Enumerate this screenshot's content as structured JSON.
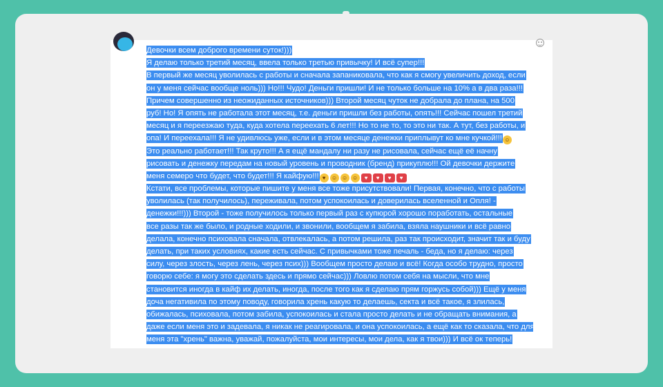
{
  "lines": [
    "Девочки всем доброго времени суток!)))",
    "Я делаю только третий месяц, ввела  только третью привычку! И всё супер!!!",
    "В первый же месяц уволилась с работы и сначала запаниковала, что как я смогу увеличить доход, если",
    "он у меня сейчас вообще ноль))) Но!!! Чудо! Деньги пришли! И не только больше на 10% а в два раза!!!",
    "Причем совершенно из неожиданных источников))) Второй месяц чуток не добрала до плана, на 500",
    "руб! Но! Я опять не работала этот месяц, т.е. деньги пришли без работы, опять!!! Сейчас пошел третий",
    "месяц и я переезжаю туда, куда хотела переехать 6 лет!!! Но то не то, то это ни так. А тут, без работы, и",
    "опа! И переехала!!! Я не удивлюсь уже, если и в этом месяце денежки приплывут ко мне кучкой!!!",
    "Это реально работает!!! Так круто!!! А я ещё мандалу ни разу не рисовала, сейчас ещё её начну",
    "рисовать и денежку передам на новый уровень и проводник (бренд) прикуплю!!! Ой девочки держите",
    "меня семеро что будет, что будет!!! Я кайфую!!!",
    "Кстати, все проблемы, которые пишите у меня все тоже присутствовали! Первая, конечно, что с работы",
    "уволилась (так получилось), переживала, потом успокоилась и доверилась вселенной и Опля! -",
    "денежки!!!))) Второй - тоже получилось только первый раз с купюрой хорошо поработать, остальные",
    "все разы так же было, и родные ходили, и звонили, вообщем я забила, взяла наушники и всё равно",
    "делала, конечно психовала сначала, отвлекалась, а потом решила, раз так происходит, значит так и буду",
    "делать, при таких условиях, какие есть сейчас. С привычками тоже печаль - беда, но я делаю: через",
    "силу, через злость, через лень, через псих))) Вообщем просто делаю и всё! Когда особо трудно, просто",
    "говорю себе: я могу это сделать здесь и прямо сейчас))) Ловлю потом себя на мысли, что мне",
    "становится иногда в кайф их делать, иногда, после того как я сделаю прям горжусь собой))) Ещё у меня",
    "доча негативила по этому поводу, говорила хрень какую то делаешь, секта и всё такое, я злилась,",
    "обижалась, психовала, потом забила, успокоилась и стала просто делать и не обращать внимания, а",
    "даже если меня это и задевала, я никак не реагировала, и она успокоилась, а ещё как то сказала, что для",
    "меня эта \"хрень\" важна, уважай, пожалуйста, мои интересы, мои дела, как я твои))) И всё ок теперь!"
  ],
  "icons": {
    "avatar": "user-avatar",
    "emoji_picker": "smiley-icon"
  },
  "colors": {
    "background": "#4fc1a9",
    "card": "#efefef",
    "selection": "#3c8df0"
  }
}
